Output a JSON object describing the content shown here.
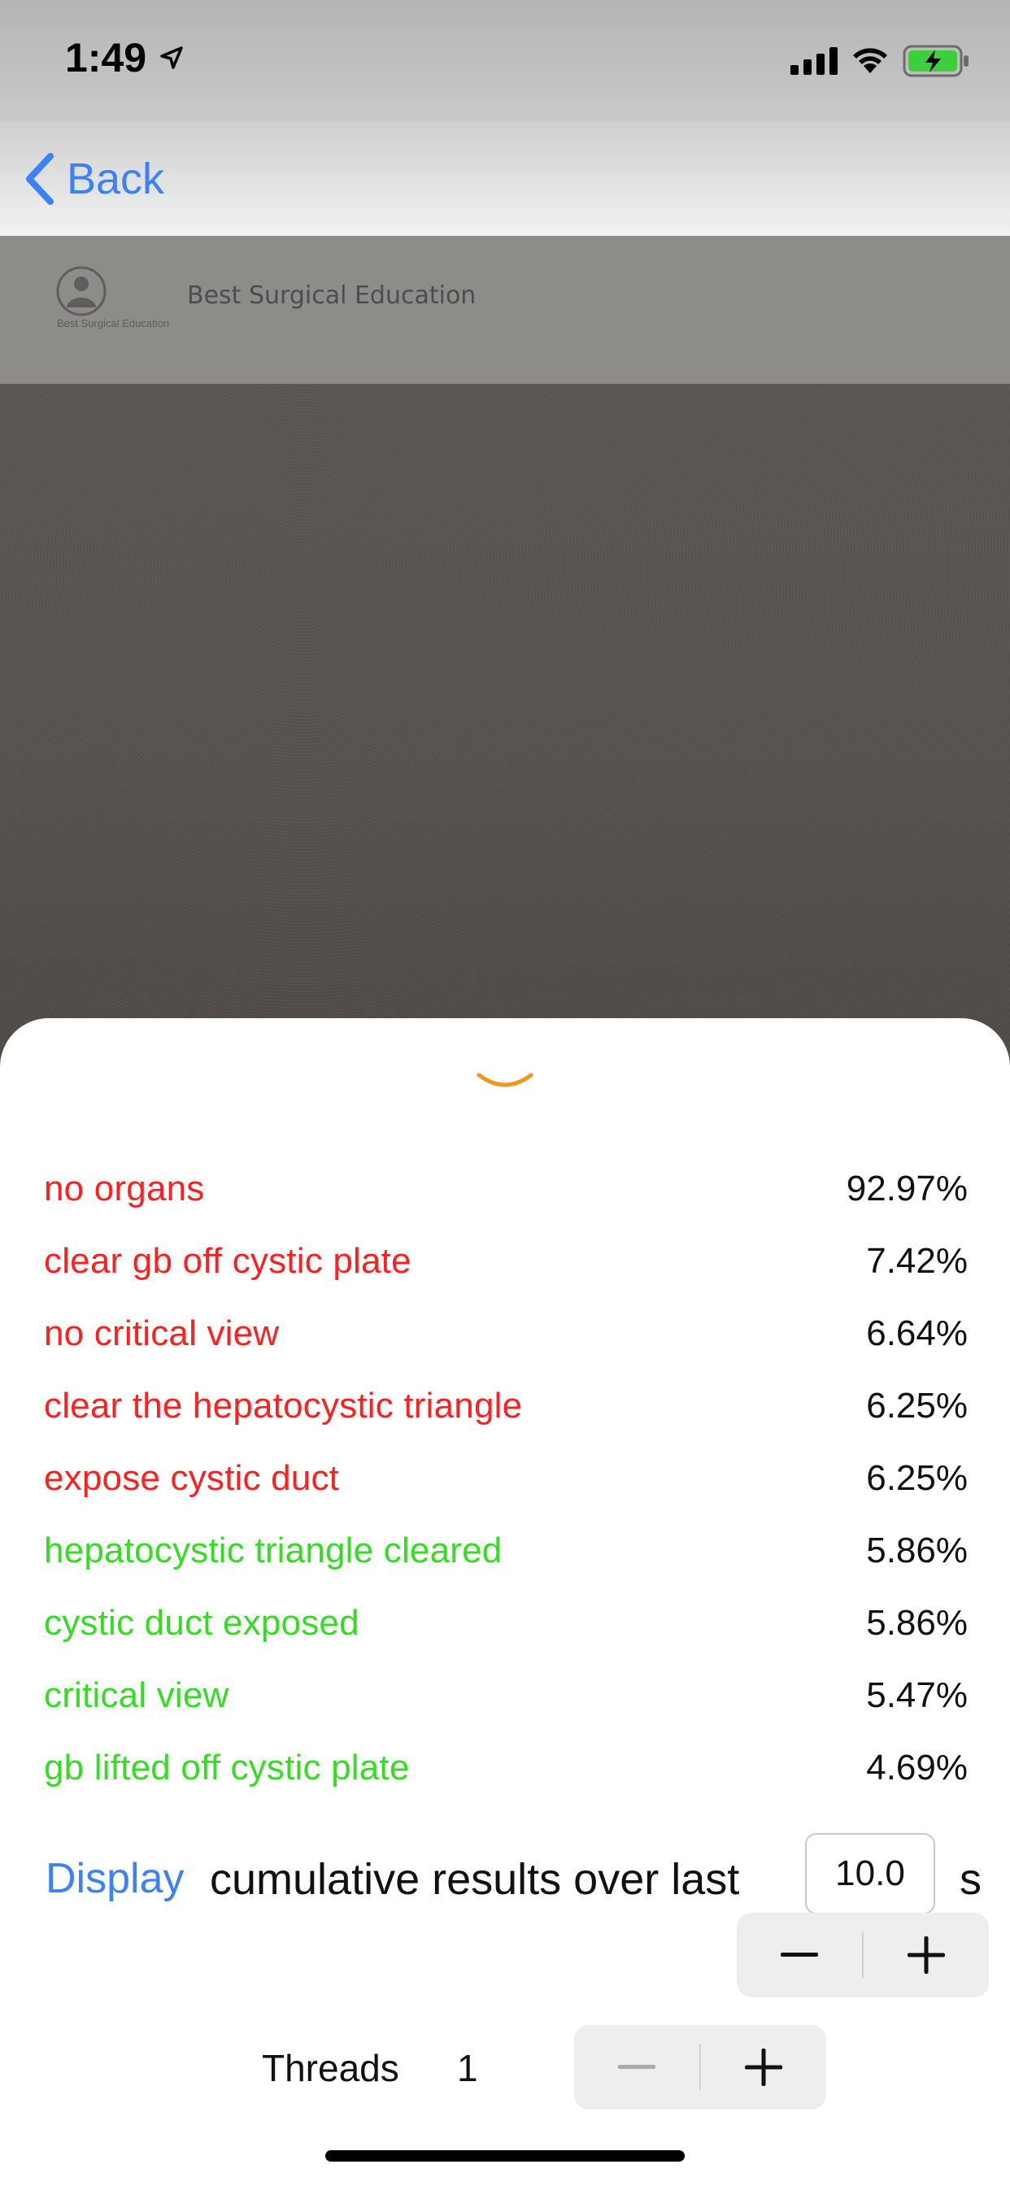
{
  "status_bar": {
    "time": "1:49",
    "icons": [
      "location-arrow-icon",
      "cellular-signal-icon",
      "wifi-icon",
      "battery-charging-icon"
    ]
  },
  "nav": {
    "back_label": "Back",
    "icon": "chevron-left-icon",
    "accent_color": "#3b82f6"
  },
  "camera": {
    "banner_title": "Best Surgical Education",
    "banner_logo_caption": "Best Surgical Education"
  },
  "sheet": {
    "handle_icon": "chevron-down-icon",
    "handle_color": "#f0961e",
    "results": [
      {
        "label": "no organs",
        "value": "92.97%",
        "color": "#ff1f1f"
      },
      {
        "label": "clear gb off cystic plate",
        "value": "7.42%",
        "color": "#ff1f1f"
      },
      {
        "label": "no critical view",
        "value": "6.64%",
        "color": "#ff1f1f"
      },
      {
        "label": "clear the hepatocystic triangle",
        "value": "6.25%",
        "color": "#ff1f1f"
      },
      {
        "label": "expose cystic duct",
        "value": "6.25%",
        "color": "#ff1f1f"
      },
      {
        "label": "hepatocystic triangle cleared",
        "value": "5.86%",
        "color": "#33dd22"
      },
      {
        "label": "cystic duct exposed",
        "value": "5.86%",
        "color": "#33dd22"
      },
      {
        "label": "critical view",
        "value": "5.47%",
        "color": "#33dd22"
      },
      {
        "label": "gb lifted off cystic plate",
        "value": "4.69%",
        "color": "#33dd22"
      }
    ],
    "display_link": "Display",
    "display_text": "cumulative results over last",
    "interval_value": "10.0",
    "interval_unit": "s",
    "threads_label": "Threads",
    "threads_value": "1"
  }
}
